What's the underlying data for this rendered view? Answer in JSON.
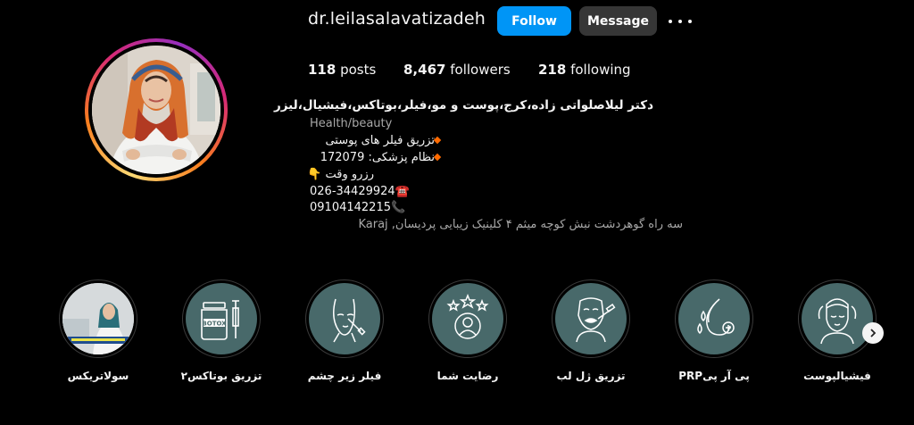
{
  "profile": {
    "username": "dr.leilasalavatizadeh",
    "follow_label": "Follow",
    "message_label": "Message",
    "more_icon": "more-options-icon"
  },
  "stats": {
    "posts_count": "118",
    "posts_label": "posts",
    "followers_count": "8,467",
    "followers_label": "followers",
    "following_count": "218",
    "following_label": "following"
  },
  "bio": {
    "name": "دکتر لیلاصلواتی زاده،کرج،پوست و مو،فیلر،بوتاکس،فیشیال،لیزر",
    "category": "Health/beauty",
    "line1": "تزریق فیلر های پوستی",
    "line2": "نظام پزشکی: 172079",
    "line3": "رزرو وقت 👇",
    "phone1": "026-34429924",
    "phone1_icon": "☎️",
    "phone2": "09104142215",
    "phone2_icon": "📞",
    "address": "سه راه گوهردشت نبش کوچه میثم ۴ کلینیک زیبایی پردیسان, Karaj"
  },
  "highlights": [
    {
      "label": "سولاتریکس",
      "icon": "photo-thumbnail"
    },
    {
      "label": "تزریق بوتاکس۲",
      "icon": "botox-vial-icon"
    },
    {
      "label": "فیلر زیر چشم",
      "icon": "face-filler-icon"
    },
    {
      "label": "رضایت شما",
      "icon": "satisfaction-stars-icon"
    },
    {
      "label": "تزریق ژل لب",
      "icon": "lip-injection-icon"
    },
    {
      "label": "پی آر پیPRP",
      "icon": "prp-drops-icon"
    },
    {
      "label": "فیشیالپوست",
      "icon": "facial-skin-icon"
    }
  ],
  "colors": {
    "background": "#000000",
    "follow_button": "#0095f6",
    "message_button": "#363636",
    "highlight_fill": "#48696a",
    "bullet": "#ff6a00"
  }
}
